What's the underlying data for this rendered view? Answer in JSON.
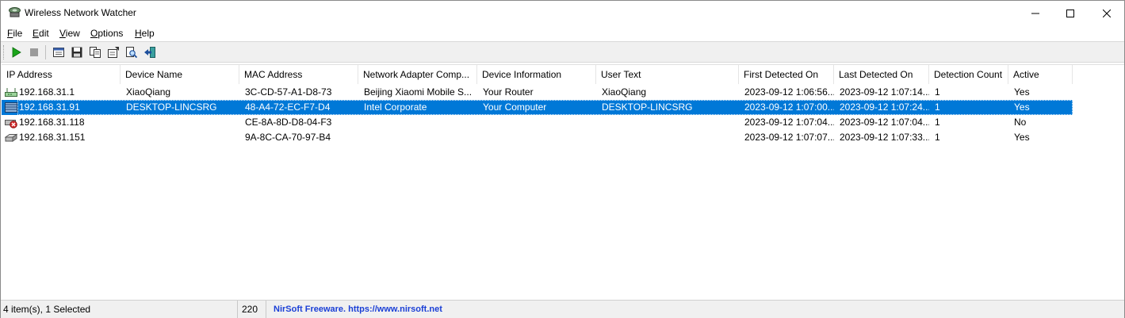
{
  "window": {
    "title": "Wireless Network Watcher",
    "icon": "network-watcher-app-icon"
  },
  "menu": {
    "items": [
      {
        "label": "File",
        "accel": "F"
      },
      {
        "label": "Edit",
        "accel": "E"
      },
      {
        "label": "View",
        "accel": "V"
      },
      {
        "label": "Options",
        "accel": "O"
      },
      {
        "label": "Help",
        "accel": "H"
      }
    ]
  },
  "toolbar": {
    "buttons": [
      {
        "name": "start-scanning-button",
        "icon": "play-icon"
      },
      {
        "name": "stop-scanning-button",
        "icon": "stop-icon"
      },
      {
        "name": "html-report-button",
        "icon": "html-report-icon"
      },
      {
        "name": "save-button",
        "icon": "save-icon"
      },
      {
        "name": "copy-button",
        "icon": "copy-icon"
      },
      {
        "name": "properties-button",
        "icon": "properties-icon"
      },
      {
        "name": "find-button",
        "icon": "find-icon"
      },
      {
        "name": "exit-button",
        "icon": "exit-icon"
      }
    ]
  },
  "table": {
    "columns": [
      "IP Address",
      "Device Name",
      "MAC Address",
      "Network Adapter Comp...",
      "Device Information",
      "User Text",
      "First Detected On",
      "Last Detected On",
      "Detection Count",
      "Active"
    ],
    "rows": [
      {
        "icon": "router-icon",
        "selected": false,
        "cells": [
          "192.168.31.1",
          "XiaoQiang",
          "3C-CD-57-A1-D8-73",
          "Beijing Xiaomi Mobile S...",
          "Your Router",
          "XiaoQiang",
          "2023-09-12 1:06:56...",
          "2023-09-12 1:07:14...",
          "1",
          "Yes"
        ]
      },
      {
        "icon": "computer-icon",
        "selected": true,
        "cells": [
          "192.168.31.91",
          "DESKTOP-LINCSRG",
          "48-A4-72-EC-F7-D4",
          "Intel Corporate",
          "Your Computer",
          "DESKTOP-LINCSRG",
          "2023-09-12 1:07:00...",
          "2023-09-12 1:07:24...",
          "1",
          "Yes"
        ]
      },
      {
        "icon": "inactive-device-icon",
        "selected": false,
        "cells": [
          "192.168.31.118",
          "",
          "CE-8A-8D-D8-04-F3",
          "",
          "",
          "",
          "2023-09-12 1:07:04...",
          "2023-09-12 1:07:04...",
          "1",
          "No"
        ]
      },
      {
        "icon": "network-device-icon",
        "selected": false,
        "cells": [
          "192.168.31.151",
          "",
          "9A-8C-CA-70-97-B4",
          "",
          "",
          "",
          "2023-09-12 1:07:07...",
          "2023-09-12 1:07:33...",
          "1",
          "Yes"
        ]
      }
    ]
  },
  "status": {
    "items_text": "4 item(s), 1 Selected",
    "count": "220",
    "link_text": "NirSoft Freeware. https://www.nirsoft.net"
  },
  "colors": {
    "selection": "#0078d7",
    "link": "#1a3fd6",
    "play": "#1aa51a"
  }
}
